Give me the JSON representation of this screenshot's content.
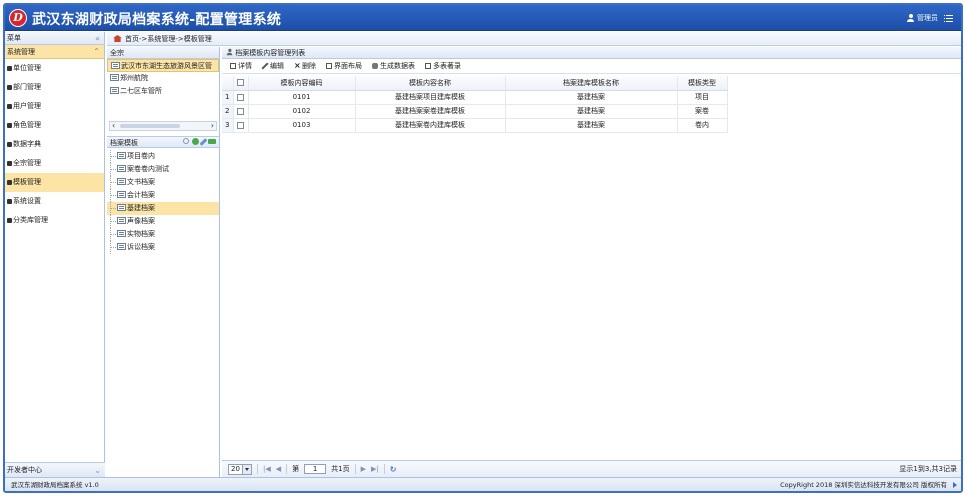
{
  "header": {
    "logo_letter": "D",
    "title": "武汉东湖财政局档案系统-配置管理系统",
    "user": "管理员"
  },
  "sidebar": {
    "title": "菜单",
    "group": "系统管理",
    "items": [
      {
        "label": "单位管理"
      },
      {
        "label": "部门管理"
      },
      {
        "label": "用户管理"
      },
      {
        "label": "角色管理"
      },
      {
        "label": "数据字典"
      },
      {
        "label": "全宗管理"
      },
      {
        "label": "模板管理",
        "active": true
      },
      {
        "label": "系统设置"
      },
      {
        "label": "分类库管理"
      }
    ],
    "dev_center": "开发者中心"
  },
  "breadcrumb": "首页->系统管理->模板管理",
  "org_panel": {
    "title": "全宗",
    "items": [
      "武汉市东湖生态旅游风景区管",
      "郑州航院",
      "二七区车管所"
    ]
  },
  "template_panel": {
    "title": "档案模板",
    "items": [
      "项目卷内",
      "案卷卷内测试",
      "文书档案",
      "会计档案",
      "基建档案",
      "声像档案",
      "实物档案",
      "诉讼档案"
    ],
    "selected_index": 4
  },
  "main": {
    "title": "档案模板内容管理列表",
    "toolbar": [
      "详情",
      "编辑",
      "删除",
      "界面布局",
      "生成数据表",
      "多表著录"
    ],
    "columns": [
      "模板内容编码",
      "模板内容名称",
      "档案建库模板名称",
      "模板类型"
    ],
    "rows": [
      {
        "no": "1",
        "code": "0101",
        "name": "基建档案项目建库模板",
        "lib": "基建档案",
        "type": "项目"
      },
      {
        "no": "2",
        "code": "0102",
        "name": "基建档案案卷建库模板",
        "lib": "基建档案",
        "type": "案卷"
      },
      {
        "no": "3",
        "code": "0103",
        "name": "基建档案卷内建库模板",
        "lib": "基建档案",
        "type": "卷内"
      }
    ],
    "pager": {
      "page_size": "20",
      "page_label_pre": "第",
      "page": "1",
      "page_label_post": "共1页",
      "info": "显示1到3,共3记录"
    }
  },
  "footer": {
    "left": "武汉东湖财政局档案系统 v1.0",
    "right": "CopyRight 2018 深圳实信达科技开发有限公司 版权所有"
  }
}
